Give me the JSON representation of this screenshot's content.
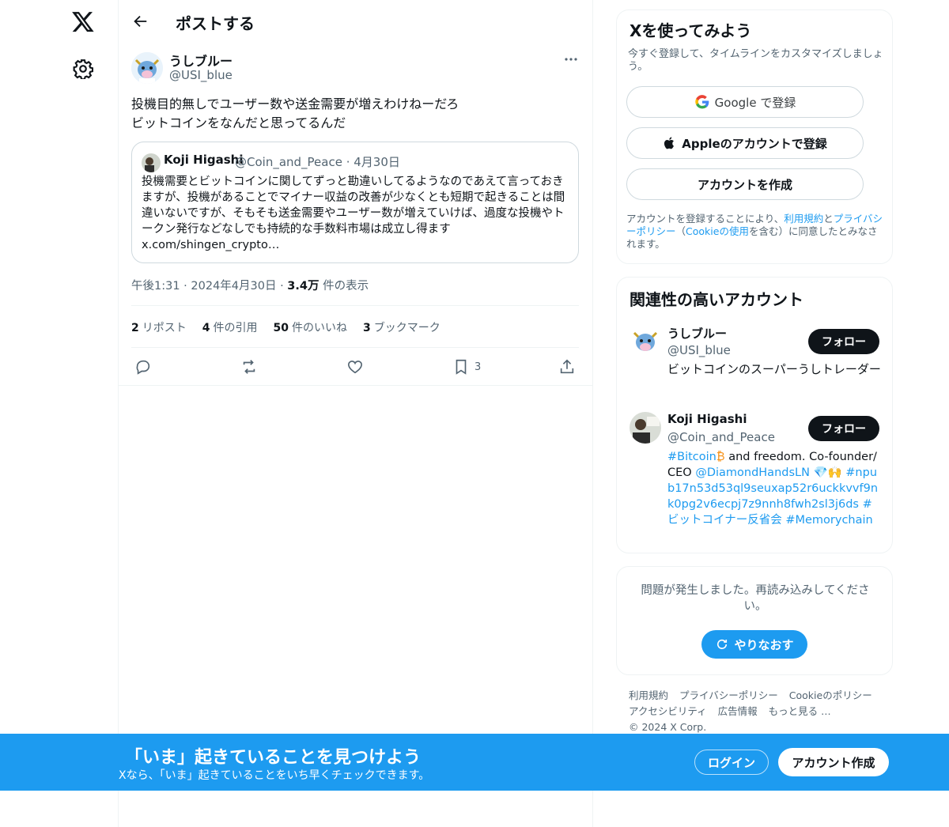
{
  "header": {
    "title": "ポストする"
  },
  "post": {
    "author_name": "うしブルー",
    "author_handle": "@USI_blue",
    "text": "投機目的無しでユーザー数や送金需要が増えわけねーだろ\nビットコインをなんだと思ってるんだ",
    "quote": {
      "name": "Koji Higashi",
      "handle": "@Coin_and_Peace · 4月30日",
      "text": "投機需要とビットコインに関してずっと勘違いしてるようなのであえて言っておきますが、投機があることでマイナー収益の改善が少なくとも短期で起きることは間違いないですが、そもそも送金需要やユーザー数が増えていけば、過度な投機やトークン発行などなしでも持続的な手数料市場は成立し得ます x.com/shingen_crypto…"
    },
    "time": "午後1:31 · 2024年4月30日 · ",
    "views": "3.4万",
    "views_label": "件の表示",
    "stats": [
      {
        "count": "2",
        "label": "リポスト"
      },
      {
        "count": "4",
        "label": "件の引用"
      },
      {
        "count": "50",
        "label": "件のいいね"
      },
      {
        "count": "3",
        "label": "ブックマーク"
      }
    ],
    "bookmark_count": "3"
  },
  "signup_card": {
    "title": "Xを使ってみよう",
    "subtitle": "今すぐ登録して、タイムラインをカスタマイズしましょう。",
    "google_label": "Google で登録",
    "apple_label": "Appleのアカウントで登録",
    "create_label": "アカウントを作成",
    "legal_1": "アカウントを登録することにより、",
    "legal_terms": "利用規約",
    "legal_2": "と",
    "legal_privacy": "プライバシーポリシー",
    "legal_3": "（",
    "legal_cookie": "Cookieの使用",
    "legal_4": "を含む）に同意したとみなされます。"
  },
  "related": {
    "title": "関連性の高いアカウント",
    "follow_label": "フォロー",
    "accounts": [
      {
        "name": "うしブルー",
        "handle": "@USI_blue",
        "bio": "ビットコインのスーパーうしトレーダー"
      },
      {
        "name": "Koji Higashi",
        "handle": "@Coin_and_Peace",
        "bio_parts": [
          "#Bitcoin",
          "₿",
          " and freedom. Co-founder/CEO ",
          "@DiamondHandsLN",
          " 💎🙌 ",
          "#npub17n53d53ql9seuxap52r6uckkvvf9nk0pg2v6ecpj7z9nnh8fwh2sl3j6ds",
          " ",
          "#ビットコイナー反省会",
          " ",
          "#Memorychain"
        ]
      }
    ]
  },
  "error_card": {
    "message": "問題が発生しました。再読み込みしてください。",
    "retry_label": "やりなおす"
  },
  "footer": {
    "links": [
      "利用規約",
      "プライバシーポリシー",
      "Cookieのポリシー",
      "アクセシビリティ",
      "広告情報",
      "もっと見る …",
      "© 2024 X Corp."
    ]
  },
  "banner": {
    "title": "「いま」起きていることを見つけよう",
    "subtitle": "Xなら、「いま」起きていることをいち早くチェックできます。",
    "login_label": "ログイン",
    "signup_label": "アカウント作成"
  },
  "colors": {
    "accent": "#1d9bf0",
    "text": "#0f1419",
    "muted": "#536471",
    "border": "#eff3f4"
  }
}
